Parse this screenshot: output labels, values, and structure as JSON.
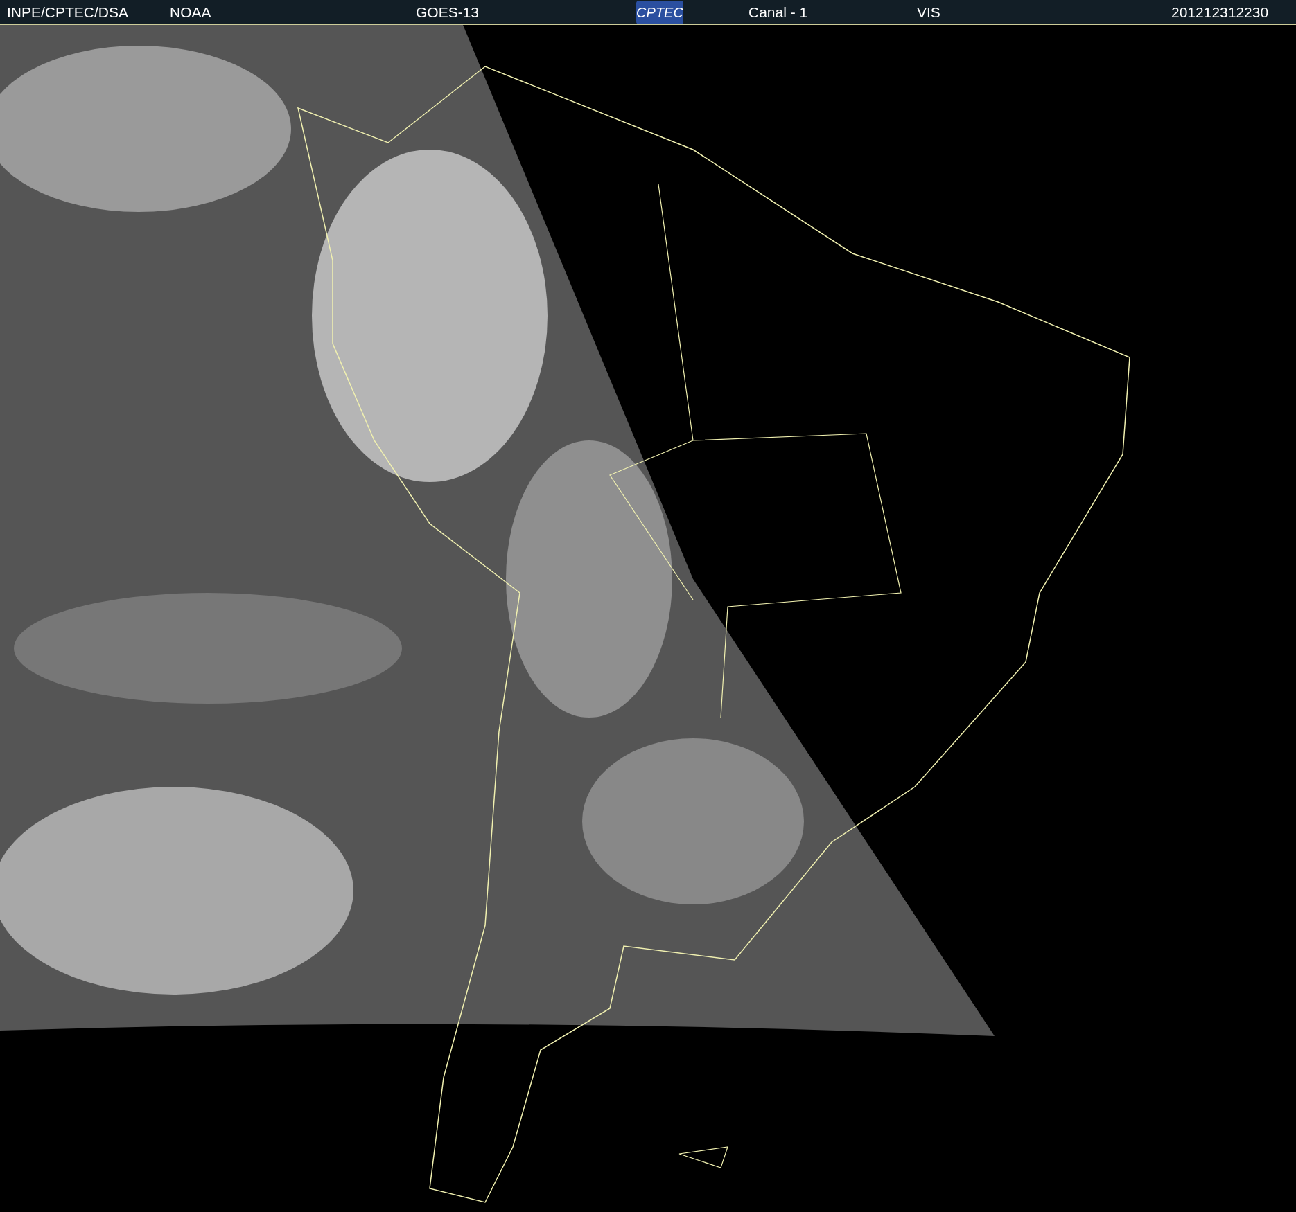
{
  "header": {
    "source": "INPE/CPTEC/DSA",
    "agency": "NOAA",
    "satellite": "GOES-13",
    "logo": "CPTEC",
    "channel": "Canal - 1",
    "band": "VIS",
    "timestamp": "201212312230"
  }
}
